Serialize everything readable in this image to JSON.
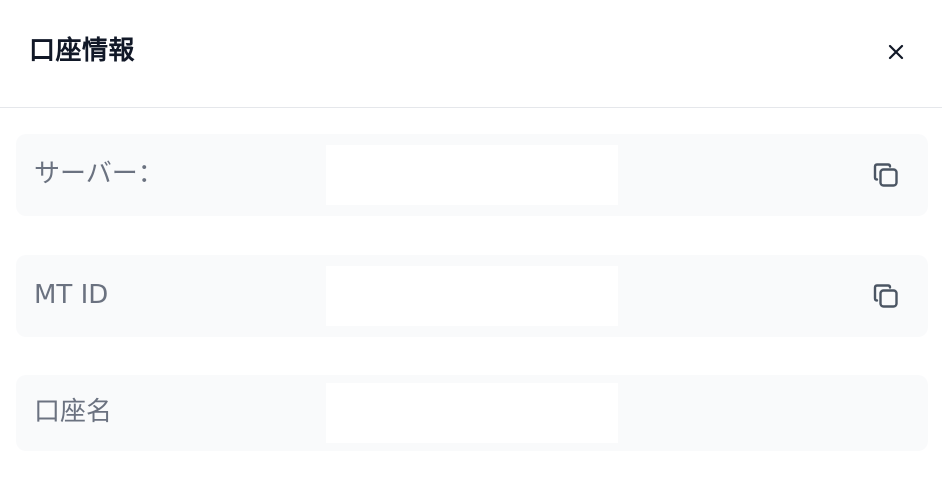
{
  "dialog": {
    "title": "口座情報",
    "close_icon": "close-icon"
  },
  "rows": [
    {
      "label": "サーバー：",
      "value": "",
      "copyable": true,
      "copy_icon": "copy-icon"
    },
    {
      "label": "MT ID",
      "value": "",
      "copyable": true,
      "copy_icon": "copy-icon"
    },
    {
      "label": "口座名",
      "value": "",
      "copyable": false
    }
  ],
  "colors": {
    "title": "#111827",
    "label": "#6b7280",
    "row_background": "#f9fafb",
    "divider": "#e5e7eb",
    "icon": "#4b5563"
  }
}
